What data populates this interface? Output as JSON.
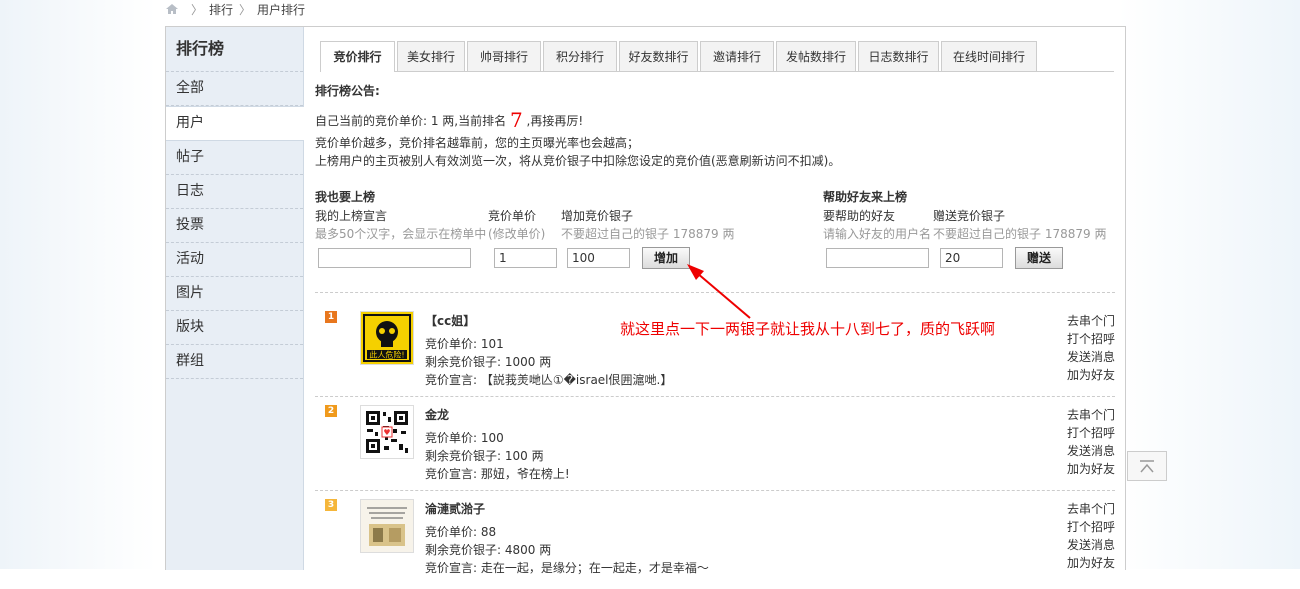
{
  "breadcrumb": {
    "items": [
      "排行",
      "用户排行"
    ]
  },
  "sidebar": {
    "title": "排行榜",
    "items": [
      "全部",
      "用户",
      "帖子",
      "日志",
      "投票",
      "活动",
      "图片",
      "版块",
      "群组"
    ],
    "active_index": 1
  },
  "tabs": [
    "竞价排行",
    "美女排行",
    "帅哥排行",
    "积分排行",
    "好友数排行",
    "邀请排行",
    "发帖数排行",
    "日志数排行",
    "在线时间排行"
  ],
  "notice": {
    "title": "排行榜公告:",
    "line1_prefix": "自己当前的竞价单价: 1 两,当前排名",
    "rank": "7",
    "line1_suffix": ",再接再厉!",
    "line2": "竞价单价越多，竞价排名越靠前，您的主页曝光率也会越高；",
    "line3": "上榜用户的主页被别人有效浏览一次，将从竞价银子中扣除您设定的竞价值(恶意刷新访问不扣减)。"
  },
  "self_form": {
    "title": "我也要上榜",
    "decl_label": "我的上榜宣言",
    "decl_hint": "最多50个汉字，会显示在榜单中",
    "price_label": "竞价单价",
    "price_hint": "(修改单价)",
    "add_label": "增加竞价银子",
    "add_hint": "不要超过自己的银子 178879 两",
    "price_value": "1",
    "add_value": "100",
    "button": "增加"
  },
  "friend_form": {
    "title": "帮助好友来上榜",
    "friend_label": "要帮助的好友",
    "friend_hint": "请输入好友的用户名",
    "gift_label": "赠送竞价银子",
    "gift_hint": "不要超过自己的银子 178879 两",
    "gift_value": "20",
    "button": "赠送"
  },
  "records": [
    {
      "rank": "1",
      "name": "【cc姐】",
      "price": "竞价单价: 101",
      "remain": "剩余竞价银子: 1000 两",
      "decl": "竞价宣言: 【説莪羙哋亾①�israel佷囲滬哋.】"
    },
    {
      "rank": "2",
      "name": "金龙",
      "price": "竞价单价: 100",
      "remain": "剩余竞价银子: 100 两",
      "decl": "竞价宣言: 那妞，爷在榜上!"
    },
    {
      "rank": "3",
      "name": "淪漣贰湁子",
      "price": "竞价单价: 88",
      "remain": "剩余竞价银子: 4800 两",
      "decl": "竞价宣言: 走在一起，是缘分；在一起走，才是幸福～"
    }
  ],
  "actions": [
    "去串个门",
    "打个招呼",
    "发送消息",
    "加为好友"
  ],
  "annotation": "就这里点一下一两银子就让我从十八到七了，质的飞跃啊",
  "colors": {
    "rank1": "#e8771e",
    "rank2": "#f09a1c",
    "rank3": "#f5b63a",
    "annotation": "#ee0000",
    "highlight": "#ee0000"
  }
}
